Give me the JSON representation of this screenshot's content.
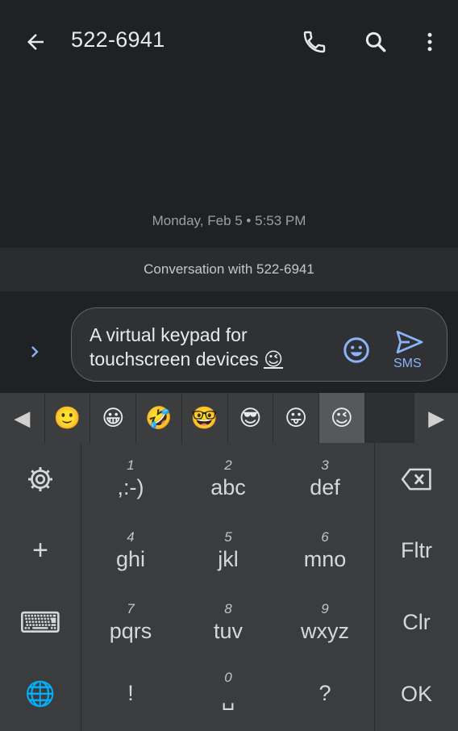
{
  "header": {
    "title": "522-6941",
    "icons": [
      "back-arrow-icon",
      "phone-icon",
      "search-icon",
      "more-vert-icon"
    ]
  },
  "timestamp": "Monday, Feb 5 • 5:53 PM",
  "banner": "Conversation with 522-6941",
  "compose": {
    "line1": "A virtual keypad for",
    "line2": "touchscreen devices ",
    "trailing_emoji": "😉",
    "send_label": "SMS"
  },
  "emoji_strip": {
    "left_arrow": "◀",
    "right_arrow": "▶",
    "emojis": [
      "🙂",
      "😀",
      "🤣",
      "🤓",
      "😎",
      "😛",
      "😉"
    ],
    "selected_index": 6
  },
  "keypad": {
    "left": {
      "settings_icon": "settings-gear-icon",
      "plus": "+",
      "keyboard": "⌨",
      "globe": "🌐"
    },
    "keys": [
      {
        "digit": "1",
        "letters": ",:-)"
      },
      {
        "digit": "2",
        "letters": "abc"
      },
      {
        "digit": "3",
        "letters": "def"
      },
      {
        "digit": "4",
        "letters": "ghi"
      },
      {
        "digit": "5",
        "letters": "jkl"
      },
      {
        "digit": "6",
        "letters": "mno"
      },
      {
        "digit": "7",
        "letters": "pqrs"
      },
      {
        "digit": "8",
        "letters": "tuv"
      },
      {
        "digit": "9",
        "letters": "wxyz"
      }
    ],
    "bottom": {
      "exclaim": "!",
      "zero_digit": "0",
      "space_symbol": "␣",
      "question": "?"
    },
    "right": {
      "backspace_icon": "backspace-icon",
      "filter": "Fltr",
      "clear": "Clr",
      "ok": "OK"
    }
  },
  "colors": {
    "background": "#202124",
    "accent": "#8ab4f8",
    "keypad": "#3b3c3e"
  }
}
